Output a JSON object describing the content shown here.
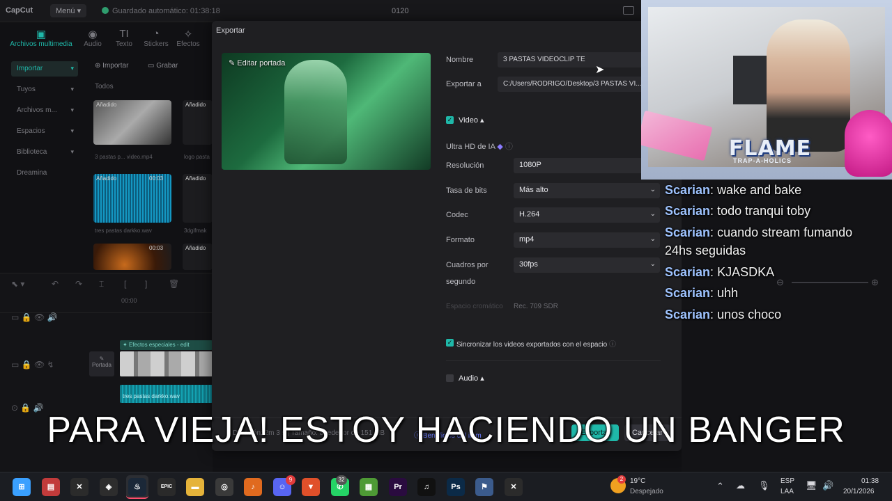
{
  "app": {
    "logo": "CapCut",
    "menu_label": "Menú",
    "autosave": "Guardado automático: 01:38:18",
    "project_name": "0120"
  },
  "media_tabs": [
    {
      "glyph": "▣",
      "label": "Archivos multimedia"
    },
    {
      "glyph": "◉",
      "label": "Audio"
    },
    {
      "glyph": "TI",
      "label": "Texto"
    },
    {
      "glyph": "◔",
      "label": "Stickers"
    },
    {
      "glyph": "✧",
      "label": "Efectos"
    }
  ],
  "sidebar": [
    {
      "label": "Importar"
    },
    {
      "label": "Tuyos"
    },
    {
      "label": "Archivos m..."
    },
    {
      "label": "Espacios"
    },
    {
      "label": "Biblioteca"
    },
    {
      "label": "Dreamina"
    }
  ],
  "media_toolbar": {
    "import_label": "Importar",
    "record_label": "Grabar",
    "section": "Todos"
  },
  "media_items": [
    {
      "tag": "Añadido",
      "duration": "",
      "name": "3 pastas p... video.mp4"
    },
    {
      "tag": "Añadido",
      "duration": "",
      "name": "logo pasta"
    },
    {
      "tag": "Añadido",
      "duration": "00:03",
      "name": "tres pastas darkko.wav"
    },
    {
      "tag": "Añadido",
      "duration": "",
      "name": "3dgifmak"
    },
    {
      "tag": "",
      "duration": "00:03",
      "name": ""
    },
    {
      "tag": "Añadido",
      "duration": "",
      "name": ""
    }
  ],
  "timeline": {
    "time": "00:00",
    "track_label": "Efectos especiales - edit",
    "cover_label": "Portada",
    "audio_clip": "tres pastas darkko.wav"
  },
  "export_dialog": {
    "title": "Exportar",
    "edit_cover": "Editar portada",
    "name_label": "Nombre",
    "name_value": "3 PASTAS VIDEOCLIP TE",
    "export_to_label": "Exportar a",
    "export_to_value": "C:/Users/RODRIGO/Desktop/3 PASTAS VI...",
    "video_section": "Video",
    "ultra_hd": "Ultra HD de IA",
    "resolution_label": "Resolución",
    "resolution_value": "1080P",
    "bitrate_label": "Tasa de bits",
    "bitrate_value": "Más alto",
    "codec_label": "Codec",
    "codec_value": "H.264",
    "format_label": "Formato",
    "format_value": "mp4",
    "fps_label_1": "Cuadros por",
    "fps_label_2": "segundo",
    "fps_value": "30fps",
    "color_space_label": "Espacio cromático",
    "color_space_value": "Rec. 709 SDR",
    "sync_label": "Sincronizar los videos exportados con el espacio",
    "audio_section": "Audio",
    "footer_info": "Duración: 2m 3 s | Tamaño: alrededor de 151 MB",
    "footer_link": "Beneficios del item",
    "export_button": "Exportar",
    "cancel_button": "Cancelar"
  },
  "overlay": {
    "flame_title": "FLAME",
    "flame_subtitle": "TRAP-A-HOLICS"
  },
  "chat": [
    {
      "user": "Scarian",
      "message": "wake and bake"
    },
    {
      "user": "Scarian",
      "message": "todo tranqui toby"
    },
    {
      "user": "Scarian",
      "message": "cuando stream fumando"
    },
    {
      "user": "",
      "message": "24hs seguidas"
    },
    {
      "user": "Scarian",
      "message": "KJASDKA"
    },
    {
      "user": "Scarian",
      "message": "uhh"
    },
    {
      "user": "Scarian",
      "message": "unos choco"
    }
  ],
  "subtitle": "PARA VIEJA! ESTOY HACIENDO UN BANGER",
  "taskbar": {
    "apps": [
      {
        "name": "windows-start-icon",
        "glyph": "⊞",
        "color": "#3aa0ff"
      },
      {
        "name": "file-manager-icon",
        "glyph": "▤",
        "color": "#c23b3b"
      },
      {
        "name": "capcut-icon",
        "glyph": "✕",
        "color": "#2b2b2b"
      },
      {
        "name": "davinci-icon",
        "glyph": "◈",
        "color": "#2d2d2d"
      },
      {
        "name": "steam-icon",
        "glyph": "♨",
        "color": "#1b2838"
      },
      {
        "name": "epic-games-icon",
        "glyph": "EPIC",
        "color": "#2a2a2a"
      },
      {
        "name": "folder-icon",
        "glyph": "▬",
        "color": "#e5b33a"
      },
      {
        "name": "obs-icon",
        "glyph": "◎",
        "color": "#3a3a3a"
      },
      {
        "name": "fl-studio-icon",
        "glyph": "♪",
        "color": "#e06a1f"
      },
      {
        "name": "discord-icon",
        "glyph": "☺",
        "color": "#5865f2"
      },
      {
        "name": "brave-icon",
        "glyph": "▼",
        "color": "#e0502a"
      },
      {
        "name": "whatsapp-icon",
        "glyph": "✆",
        "color": "#25d366"
      },
      {
        "name": "minecraft-icon",
        "glyph": "▦",
        "color": "#4e9a35"
      },
      {
        "name": "premiere-icon",
        "glyph": "Pr",
        "color": "#2a0b3f"
      },
      {
        "name": "tiktok-icon",
        "glyph": "♫",
        "color": "#111111"
      },
      {
        "name": "photoshop-icon",
        "glyph": "Ps",
        "color": "#0b2a47"
      },
      {
        "name": "counter-strike-icon",
        "glyph": "⚑",
        "color": "#3b5b8c"
      },
      {
        "name": "capcut-active-icon",
        "glyph": "✕",
        "color": "#2b2b2b"
      }
    ],
    "badges": {
      "discord": "9",
      "whatsapp": "32",
      "weather": "2"
    },
    "weather_temp": "19°C",
    "weather_desc": "Despejado",
    "lang_1": "ESP",
    "lang_2": "LAA",
    "time": "01:38",
    "date": "20/1/2026"
  }
}
